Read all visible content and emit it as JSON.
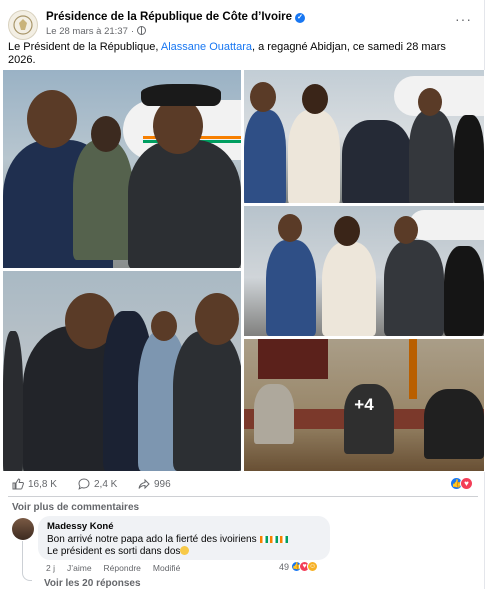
{
  "post": {
    "page_name": "Présidence de la République de Côte d’Ivoire",
    "timestamp": "Le 28 mars à 21:37",
    "dot": "·",
    "text_before": "Le Président de la République, ",
    "mention": "Alassane Ouattara",
    "text_after": ", a regagné Abidjan, ce samedi 28 mars 2026.",
    "more_photos": "+4",
    "options_label": "···"
  },
  "stats": {
    "likes": "16,8 K",
    "comments": "2,4 K",
    "shares": "996"
  },
  "comments": {
    "view_more": "Voir plus de commentaires",
    "first": {
      "author": "Madessy Koné",
      "text_line1": "Bon arrivé notre papa ado la fierté des ivoiriens",
      "text_line2": "Le président es sorti dans dos",
      "age": "2 j",
      "like": "J’aime",
      "reply": "Répondre",
      "edited": "Modifié",
      "reaction_count": "49"
    },
    "replies": "Voir les 20 réponses"
  },
  "colors": {
    "accent": "#1877f2",
    "muted": "#65676b",
    "flag_orange": "#f77f00",
    "flag_green": "#009e60"
  },
  "icons": [
    "verified-icon",
    "globe-icon",
    "more-icon",
    "like-icon",
    "comment-icon",
    "share-icon",
    "like-reaction-icon",
    "love-reaction-icon",
    "haha-reaction-icon"
  ]
}
